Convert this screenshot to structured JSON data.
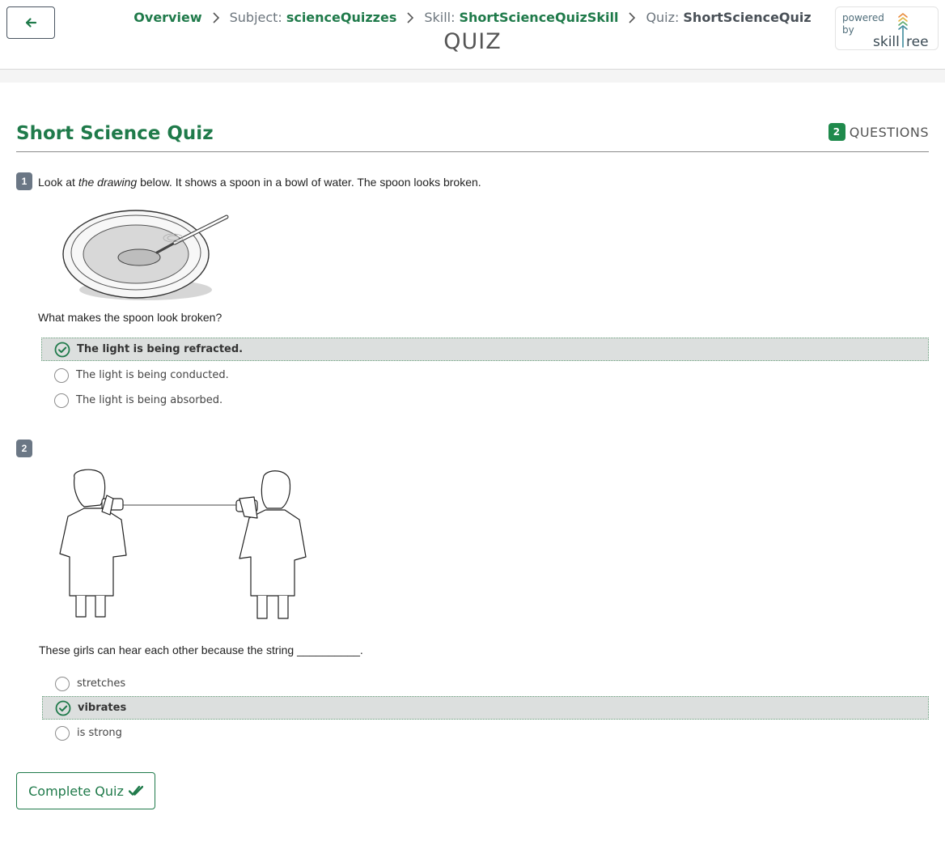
{
  "breadcrumb": {
    "overview": "Overview",
    "subject_prefix": "Subject:",
    "subject": "scienceQuizzes",
    "skill_prefix": "Skill:",
    "skill": "ShortScienceQuizSkill",
    "quiz_prefix": "Quiz:",
    "quiz": "ShortScienceQuiz"
  },
  "page_title": "QUIZ",
  "powered_by": {
    "text": "powered by",
    "logo_text": "skilltree"
  },
  "quiz": {
    "title": "Short Science Quiz",
    "question_count": "2",
    "question_count_label": "QUESTIONS"
  },
  "questions": [
    {
      "number": "1",
      "intro_before": "Look at ",
      "intro_em": "the drawing",
      "intro_after": " below. It shows a spoon in a bowl of water. The spoon looks broken.",
      "prompt": "What makes the spoon look broken?",
      "image": "spoon-in-bowl-illustration",
      "answers": [
        {
          "label": "The light is being refracted.",
          "selected": true
        },
        {
          "label": "The light is being conducted.",
          "selected": false
        },
        {
          "label": "The light is being absorbed.",
          "selected": false
        }
      ]
    },
    {
      "number": "2",
      "prompt": "These girls can hear each other because the string __________.",
      "image": "girls-tin-can-phone-illustration",
      "answers": [
        {
          "label": "stretches",
          "selected": false
        },
        {
          "label": "vibrates",
          "selected": true
        },
        {
          "label": "is strong",
          "selected": false
        }
      ]
    }
  ],
  "complete_button": "Complete Quiz",
  "colors": {
    "accent": "#1f7a4a",
    "selected_bg": "#dcdfde",
    "badge": "#6b7785"
  }
}
